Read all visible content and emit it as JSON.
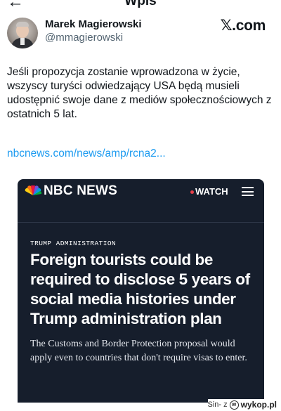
{
  "header": {
    "title": "Wpis",
    "back_glyph": "←",
    "more_glyph": "···"
  },
  "author": {
    "name": "Marek Magierowski",
    "handle": "@mmagierowski",
    "avatar": "profile-photo"
  },
  "brand": {
    "logo_text": "𝕏.com"
  },
  "tweet": {
    "text": "Jeśli propozycja zostanie wprowadzona w życie, wszyscy turyści odwiedzający USA będą musieli udostępnić swoje dane z mediów społecznościowych z ostatnich 5 lat.",
    "link": "nbcnews.com/news/amp/rcna2..."
  },
  "card": {
    "brand": "NBC NEWS",
    "watch_label": "WATCH",
    "kicker": "TRUMP ADMINISTRATION",
    "headline": "Foreign tourists could be required to disclose 5 years of social media histories under Trump administration plan",
    "dek": "The Customs and Border Protection proposal would apply even to countries that don't require visas to enter.",
    "colors": {
      "background": "#161e2c",
      "live_dot": "#e8404a"
    }
  },
  "watermark": {
    "user": "Sin- z",
    "site": "wykop.pl",
    "icon": "w"
  },
  "colors": {
    "link": "#1d9bf0",
    "secondary_text": "#536471"
  }
}
